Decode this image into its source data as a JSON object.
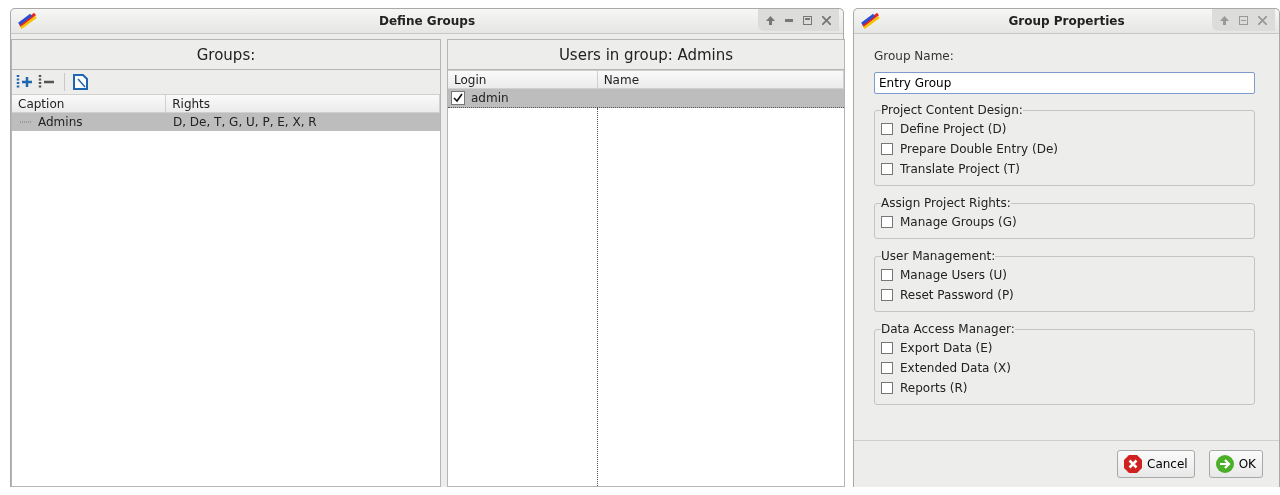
{
  "main_window": {
    "title": "Define Groups"
  },
  "groups_pane": {
    "heading": "Groups:",
    "columns": [
      "Caption",
      "Rights"
    ],
    "rows": [
      {
        "caption": "Admins",
        "rights": "D, De, T, G, U, P, E, X, R",
        "selected": true
      }
    ]
  },
  "users_pane": {
    "heading": "Users in group: Admins",
    "columns": [
      "Login",
      "Name"
    ],
    "rows": [
      {
        "login": "admin",
        "name": "",
        "checked": true,
        "selected": true
      }
    ]
  },
  "dialog": {
    "title": "Group Properties",
    "name_label": "Group Name:",
    "name_value": "Entry Group",
    "sections": [
      {
        "title": "Project Content Design:",
        "options": [
          {
            "label": "Define Project (D)",
            "checked": false
          },
          {
            "label": "Prepare Double Entry (De)",
            "checked": false
          },
          {
            "label": "Translate Project (T)",
            "checked": false
          }
        ]
      },
      {
        "title": "Assign Project Rights:",
        "options": [
          {
            "label": "Manage Groups (G)",
            "checked": false
          }
        ]
      },
      {
        "title": "User Management:",
        "options": [
          {
            "label": "Manage Users (U)",
            "checked": false
          },
          {
            "label": "Reset Password (P)",
            "checked": false
          }
        ]
      },
      {
        "title": "Data Access Manager:",
        "options": [
          {
            "label": "Export Data (E)",
            "checked": false
          },
          {
            "label": "Extended Data (X)",
            "checked": false
          },
          {
            "label": "Reports (R)",
            "checked": false
          }
        ]
      }
    ],
    "buttons": [
      {
        "kind": "cancel",
        "label": "Cancel"
      },
      {
        "kind": "ok",
        "label": "OK"
      }
    ]
  }
}
